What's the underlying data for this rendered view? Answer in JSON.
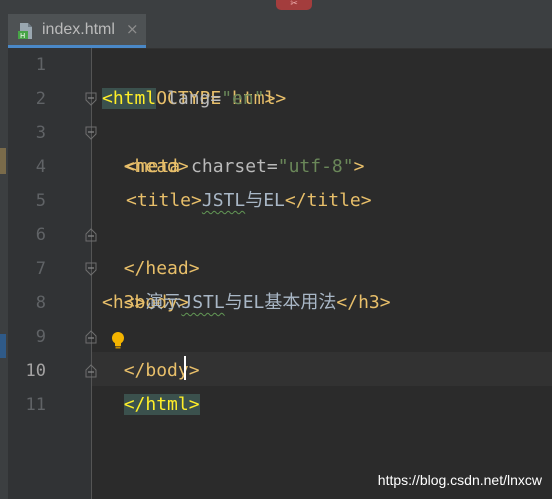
{
  "top_indicator": "✂",
  "tab": {
    "file_name": "index.html",
    "close_glyph": "×",
    "icon": "html-file-icon",
    "icon_letter": "H"
  },
  "line_numbers": [
    "1",
    "2",
    "3",
    "4",
    "5",
    "6",
    "7",
    "8",
    "9",
    "10",
    "11"
  ],
  "current_line": "10",
  "code": {
    "l1": "<!DOCTYPE html>",
    "l2_open": "<html",
    "l2_attr": " lang=",
    "l2_val": "\"en\"",
    "l2_close": ">",
    "l3": "<head>",
    "l4_open": "<meta",
    "l4_attr": " charset=",
    "l4_val": "\"utf-8\"",
    "l4_close": ">",
    "l5_open": "<title>",
    "l5_text_a": "JSTL",
    "l5_text_b": "与EL",
    "l5_close": "</title>",
    "l6": "</head>",
    "l7": "<body>",
    "l8_open": "<h3>",
    "l8_text_a": "演示",
    "l8_text_b": "JSTL",
    "l8_text_c": "与EL基本用法",
    "l8_close": "</h3>",
    "l9": "</body>",
    "l10": "</html>"
  },
  "colors": {
    "background": "#2b2b2b",
    "tag": "#e8bf6a",
    "string": "#6a8759",
    "text": "#a9b7c6",
    "tab_underline": "#4a88c7"
  },
  "watermark": "https://blog.csdn.net/lnxcw"
}
